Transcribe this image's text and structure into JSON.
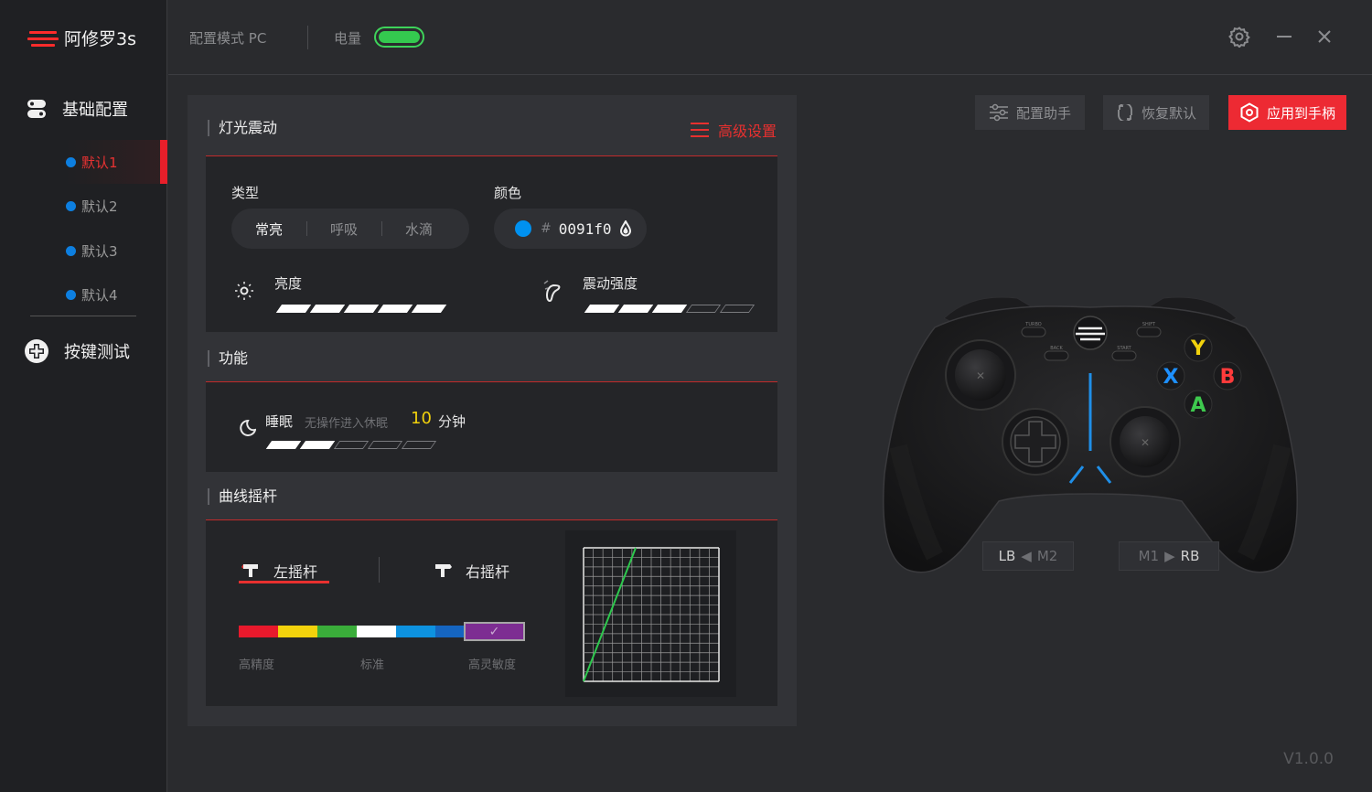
{
  "app": {
    "title": "阿修罗3s",
    "version": "V1.0.0",
    "brand_color": "#e8302f",
    "accent_blue": "#0d7fe0"
  },
  "sidebar": {
    "basic_config_label": "基础配置",
    "presets": [
      "默认1",
      "默认2",
      "默认3",
      "默认4"
    ],
    "active_preset_index": 0,
    "key_test_label": "按键测试"
  },
  "topbar": {
    "mode_label": "配置模式  PC",
    "battery_label": "电量",
    "battery_level": 1.0,
    "battery_color": "#34c94f"
  },
  "panel": {
    "light": {
      "title": "灯光震动",
      "advanced_label": "高级设置",
      "type_label": "类型",
      "types": [
        "常亮",
        "呼吸",
        "水滴"
      ],
      "selected_type_index": 0,
      "color_label": "颜色",
      "color_hash": "#",
      "color_hex": "0091f0",
      "color_value": "#0091f0",
      "brightness_label": "亮度",
      "brightness_level": 5,
      "brightness_max": 5,
      "vibration_label": "震动强度",
      "vibration_level": 3,
      "vibration_max": 5
    },
    "function": {
      "title": "功能",
      "sleep_label": "睡眠",
      "sleep_hint": "无操作进入休眠",
      "sleep_value": "10",
      "sleep_unit": "分钟",
      "sleep_level": 2,
      "sleep_max": 5
    },
    "curve": {
      "title": "曲线摇杆",
      "left_stick_label": "左摇杆",
      "right_stick_label": "右摇杆",
      "active_stick_index": 0,
      "curve_colors": [
        "#e8192c",
        "#f2d20c",
        "#3aad3a",
        "#ffffff",
        "#0d92e0",
        "#1565c0",
        "#7d2d92"
      ],
      "selected_curve_index": 6,
      "curve_labels": [
        "高精度",
        "标准",
        "高灵敏度"
      ],
      "graph_line_color": "#2ec84e"
    }
  },
  "actions": {
    "assistant_label": "配置助手",
    "restore_label": "恢复默认",
    "apply_label": "应用到手柄"
  },
  "controller": {
    "lb_label": "LB",
    "m2_label": "M2",
    "m1_label": "M1",
    "rb_label": "RB",
    "turbo_label": "TURBO",
    "shift_label": "SHIFT",
    "back_label": "BACK",
    "start_label": "START",
    "face_buttons": [
      {
        "label": "Y",
        "color": "#f2d20c"
      },
      {
        "label": "X",
        "color": "#1e90ff"
      },
      {
        "label": "B",
        "color": "#ff3b3b"
      },
      {
        "label": "A",
        "color": "#3ec94e"
      }
    ]
  }
}
